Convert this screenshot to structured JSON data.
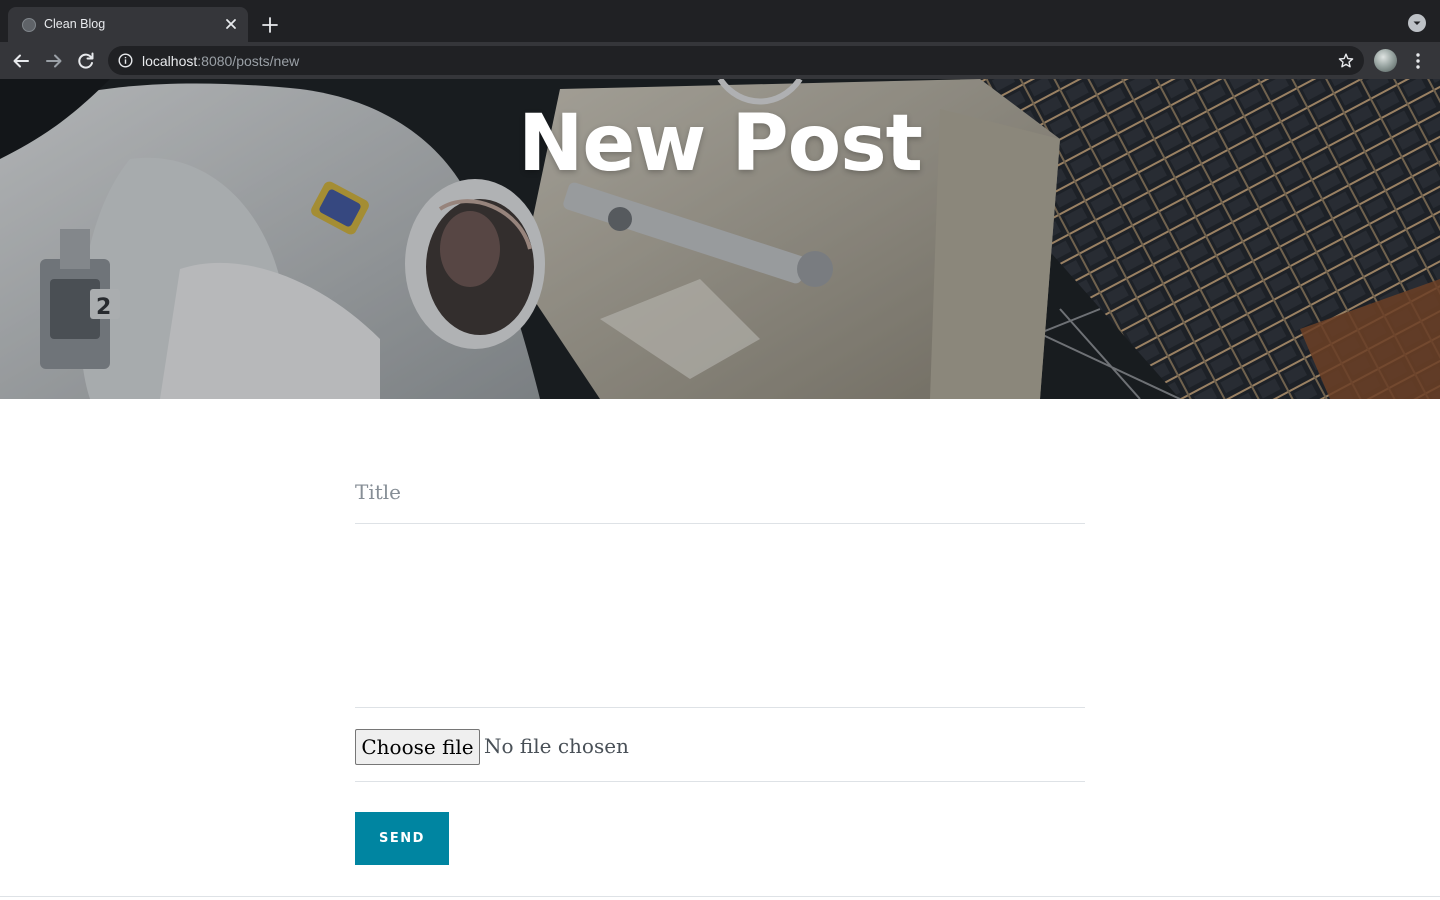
{
  "browser": {
    "tab_title": "Clean Blog",
    "url_host": "localhost",
    "url_path": ":8080/posts/new",
    "icons": {
      "favicon": "globe-icon",
      "close": "close-icon",
      "new_tab": "plus-icon",
      "tab_search": "chevron-down-icon",
      "back": "arrow-left-icon",
      "forward": "arrow-right-icon",
      "reload": "reload-icon",
      "site_info": "info-icon",
      "bookmark": "star-icon",
      "menu": "kebab-menu-icon"
    },
    "colors": {
      "tabstrip": "#202124",
      "toolbar": "#35363a",
      "omnibox": "#202124"
    }
  },
  "header": {
    "heading": "New Post",
    "background_image": "astronaut-space-station"
  },
  "form": {
    "title_placeholder": "Title",
    "title_value": "",
    "body_value": "",
    "file_button_label": "Choose file",
    "file_status": "No file chosen",
    "submit_label": "SEND"
  },
  "colors": {
    "accent": "#0085a1",
    "placeholder": "#868e96",
    "divider": "#dee2e6"
  }
}
